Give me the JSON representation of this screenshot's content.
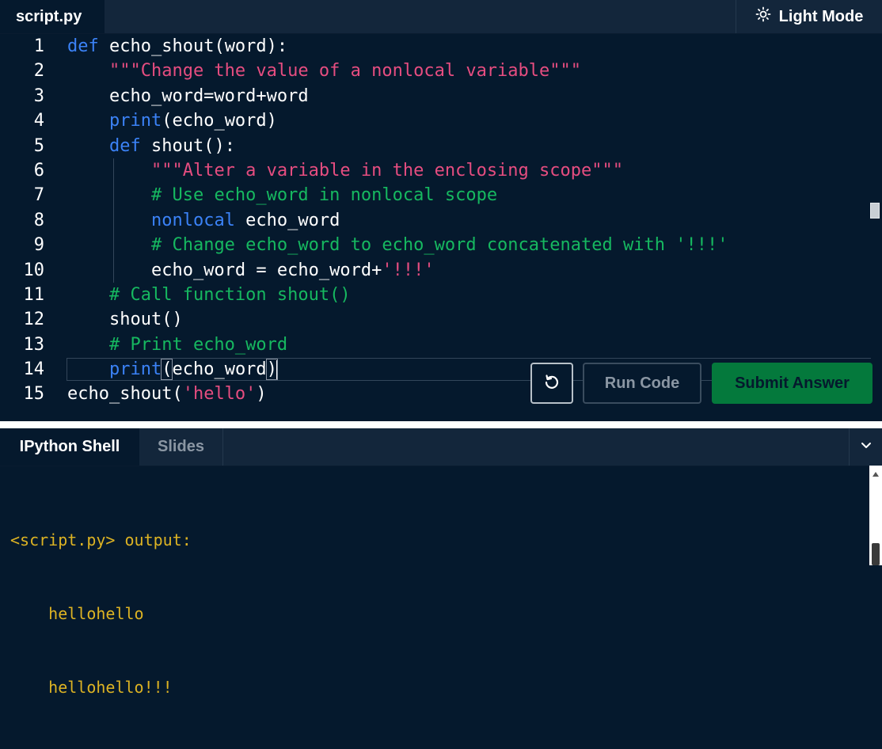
{
  "editor": {
    "tab_label": "script.py",
    "light_mode_label": "Light Mode",
    "lines": [
      {
        "num": "1",
        "tokens": [
          {
            "t": "def",
            "c": "kw"
          },
          {
            "t": " echo_shout(word):",
            "c": ""
          }
        ]
      },
      {
        "num": "2",
        "tokens": [
          {
            "t": "    ",
            "c": ""
          },
          {
            "t": "\"\"\"Change the value of a nonlocal variable\"\"\"",
            "c": "str"
          }
        ]
      },
      {
        "num": "3",
        "tokens": [
          {
            "t": "    echo_word=word+word",
            "c": ""
          }
        ]
      },
      {
        "num": "4",
        "tokens": [
          {
            "t": "    ",
            "c": ""
          },
          {
            "t": "print",
            "c": "kw"
          },
          {
            "t": "(echo_word)",
            "c": ""
          }
        ]
      },
      {
        "num": "5",
        "tokens": [
          {
            "t": "    ",
            "c": ""
          },
          {
            "t": "def",
            "c": "kw"
          },
          {
            "t": " shout():",
            "c": ""
          }
        ]
      },
      {
        "num": "6",
        "tokens": [
          {
            "t": "        ",
            "c": ""
          },
          {
            "t": "\"\"\"Alter a variable in the enclosing scope\"\"\"",
            "c": "str"
          }
        ]
      },
      {
        "num": "7",
        "tokens": [
          {
            "t": "        ",
            "c": ""
          },
          {
            "t": "# Use echo_word in nonlocal scope",
            "c": "com"
          }
        ]
      },
      {
        "num": "8",
        "tokens": [
          {
            "t": "        ",
            "c": ""
          },
          {
            "t": "nonlocal",
            "c": "kw"
          },
          {
            "t": " echo_word",
            "c": ""
          }
        ]
      },
      {
        "num": "9",
        "tokens": [
          {
            "t": "        ",
            "c": ""
          },
          {
            "t": "# Change echo_word to echo_word concatenated with '!!!'",
            "c": "com"
          }
        ]
      },
      {
        "num": "10",
        "tokens": [
          {
            "t": "        echo_word = echo_word+",
            "c": ""
          },
          {
            "t": "'!!!'",
            "c": "str"
          }
        ]
      },
      {
        "num": "11",
        "tokens": [
          {
            "t": "    ",
            "c": ""
          },
          {
            "t": "# Call function shout()",
            "c": "com"
          }
        ]
      },
      {
        "num": "12",
        "tokens": [
          {
            "t": "    shout()",
            "c": ""
          }
        ]
      },
      {
        "num": "13",
        "tokens": [
          {
            "t": "    ",
            "c": ""
          },
          {
            "t": "# Print echo_word",
            "c": "com"
          }
        ]
      },
      {
        "num": "14",
        "tokens": [
          {
            "t": "    ",
            "c": ""
          },
          {
            "t": "print",
            "c": "kw"
          },
          {
            "t": "(",
            "c": "bracket"
          },
          {
            "t": "echo_word",
            "c": ""
          },
          {
            "t": ")",
            "c": "bracket"
          }
        ],
        "active": true
      },
      {
        "num": "15",
        "tokens": [
          {
            "t": "echo_shout(",
            "c": ""
          },
          {
            "t": "'hello'",
            "c": "str"
          },
          {
            "t": ")",
            "c": ""
          }
        ]
      }
    ]
  },
  "buttons": {
    "reset_icon": "reset-icon",
    "run_label": "Run Code",
    "submit_label": "Submit Answer"
  },
  "shell": {
    "tabs": [
      {
        "label": "IPython Shell",
        "active": true
      },
      {
        "label": "Slides",
        "active": false
      }
    ],
    "collapse_icon": "chevron-down-icon",
    "output_lines": [
      "<script.py> output:",
      "    hellohello",
      "    hellohello!!!"
    ]
  },
  "colors": {
    "background": "#05192d",
    "keyword": "#3b82f6",
    "string": "#e64d80",
    "comment": "#16b860",
    "output": "#ddb323",
    "submit": "#04793c"
  }
}
